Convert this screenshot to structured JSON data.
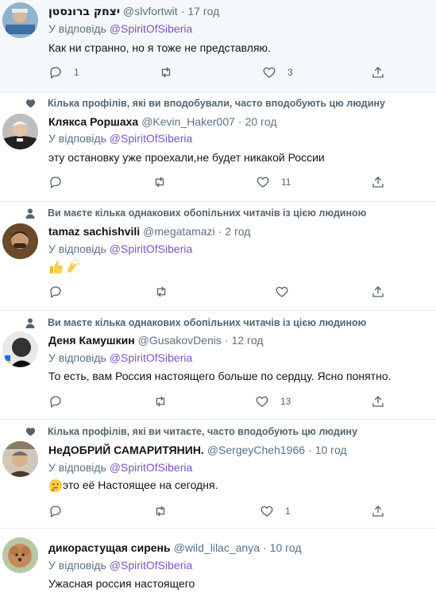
{
  "reply_prefix": "У відповідь",
  "reply_to": "@SpiritOfSiberia",
  "tweets": [
    {
      "social_context": "",
      "name": "יצחק ברונסטן",
      "handle": "@slvfortwit",
      "time": "17 год",
      "text": "Как ни странно, но я тоже не представляю.",
      "reply_count": "1",
      "retweet_count": "",
      "like_count": "3"
    },
    {
      "social_context": "Кілька профілів, які ви вподобували, часто вподобують цю людину",
      "social_icon": "heart-icon",
      "name": "Клякса Роршаха",
      "handle": "@Kevin_Haker007",
      "time": "20 год",
      "text": "эту остановку уже проехали,не будет никакой России",
      "reply_count": "",
      "retweet_count": "",
      "like_count": "11"
    },
    {
      "social_context": "Ви маєте кілька однакових обопільних читачів із цією людиною",
      "social_icon": "person-icon",
      "name": "tamaz sachishvili",
      "handle": "@megatamazi",
      "time": "2 год",
      "text": "",
      "emojis": [
        "thumbs-up-emoji",
        "clapping-hands-emoji"
      ],
      "reply_count": "",
      "retweet_count": "",
      "like_count": ""
    },
    {
      "social_context": "Ви маєте кілька однакових обопільних читачів із цією людиною",
      "social_icon": "person-icon",
      "name": "Деня Камушкин",
      "handle": "@GusakovDenis",
      "time": "12 год",
      "text": "То есть, вам Россия настоящего больше по сердцу. Ясно понятно.",
      "reply_count": "",
      "retweet_count": "",
      "like_count": "13"
    },
    {
      "social_context": "Кілька профілів, які ви читаєте, часто вподобують цю людину",
      "social_icon": "heart-icon",
      "name": "НеДОБРИЙ САМАРИТЯНИН.",
      "handle": "@SergeyCheh1966",
      "time": "10 год",
      "text": "это её Настоящее на сегодня.",
      "emojis": [
        "thinking-face-emoji"
      ],
      "reply_count": "",
      "retweet_count": "",
      "like_count": "1"
    },
    {
      "social_context": "",
      "name": "дикорастущая сирень",
      "handle": "@wild_lilac_anya",
      "time": "10 год",
      "text": "Ужасная россия настоящего",
      "reply_count": "",
      "retweet_count": "",
      "like_count": ""
    }
  ],
  "colors": {
    "accent": "#7856c7",
    "muted": "#5b7083",
    "highlight_bg": "#f5f8fa",
    "divider": "#e6ecf0"
  }
}
